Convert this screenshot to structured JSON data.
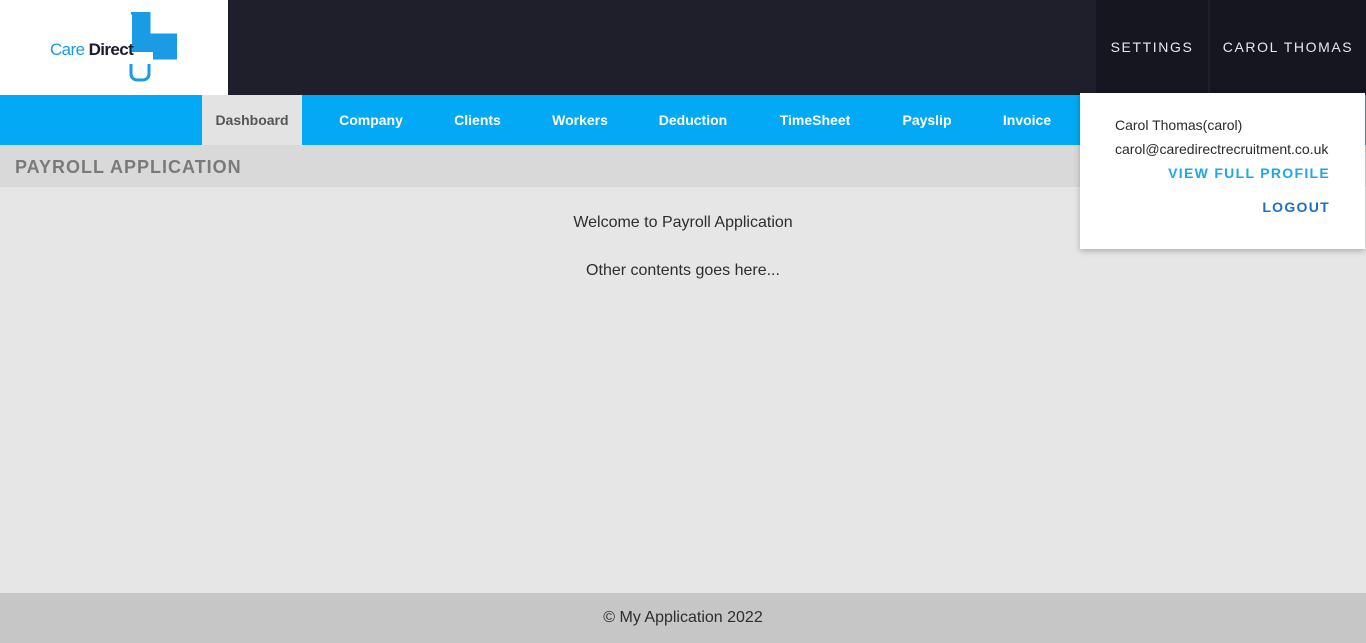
{
  "brand": {
    "care": "Care",
    "direct": "Direct",
    "accent_color": "#03a9f4"
  },
  "header": {
    "settings_label": "SETTINGS",
    "user_label": "CAROL THOMAS"
  },
  "nav": {
    "items": [
      {
        "label": "Dashboard",
        "active": true
      },
      {
        "label": "Company"
      },
      {
        "label": "Clients"
      },
      {
        "label": "Workers"
      },
      {
        "label": "Deduction"
      },
      {
        "label": "TimeSheet"
      },
      {
        "label": "Payslip"
      },
      {
        "label": "Invoice"
      }
    ]
  },
  "page": {
    "title": "PAYROLL APPLICATION"
  },
  "main": {
    "welcome": "Welcome to Payroll Application",
    "other": "Other contents goes here..."
  },
  "footer": {
    "text": "© My Application 2022"
  },
  "user_menu": {
    "name": "Carol Thomas(carol)",
    "email": "carol@caredirectrecruitment.co.uk",
    "view_profile": "VIEW FULL PROFILE",
    "logout": "LOGOUT"
  }
}
